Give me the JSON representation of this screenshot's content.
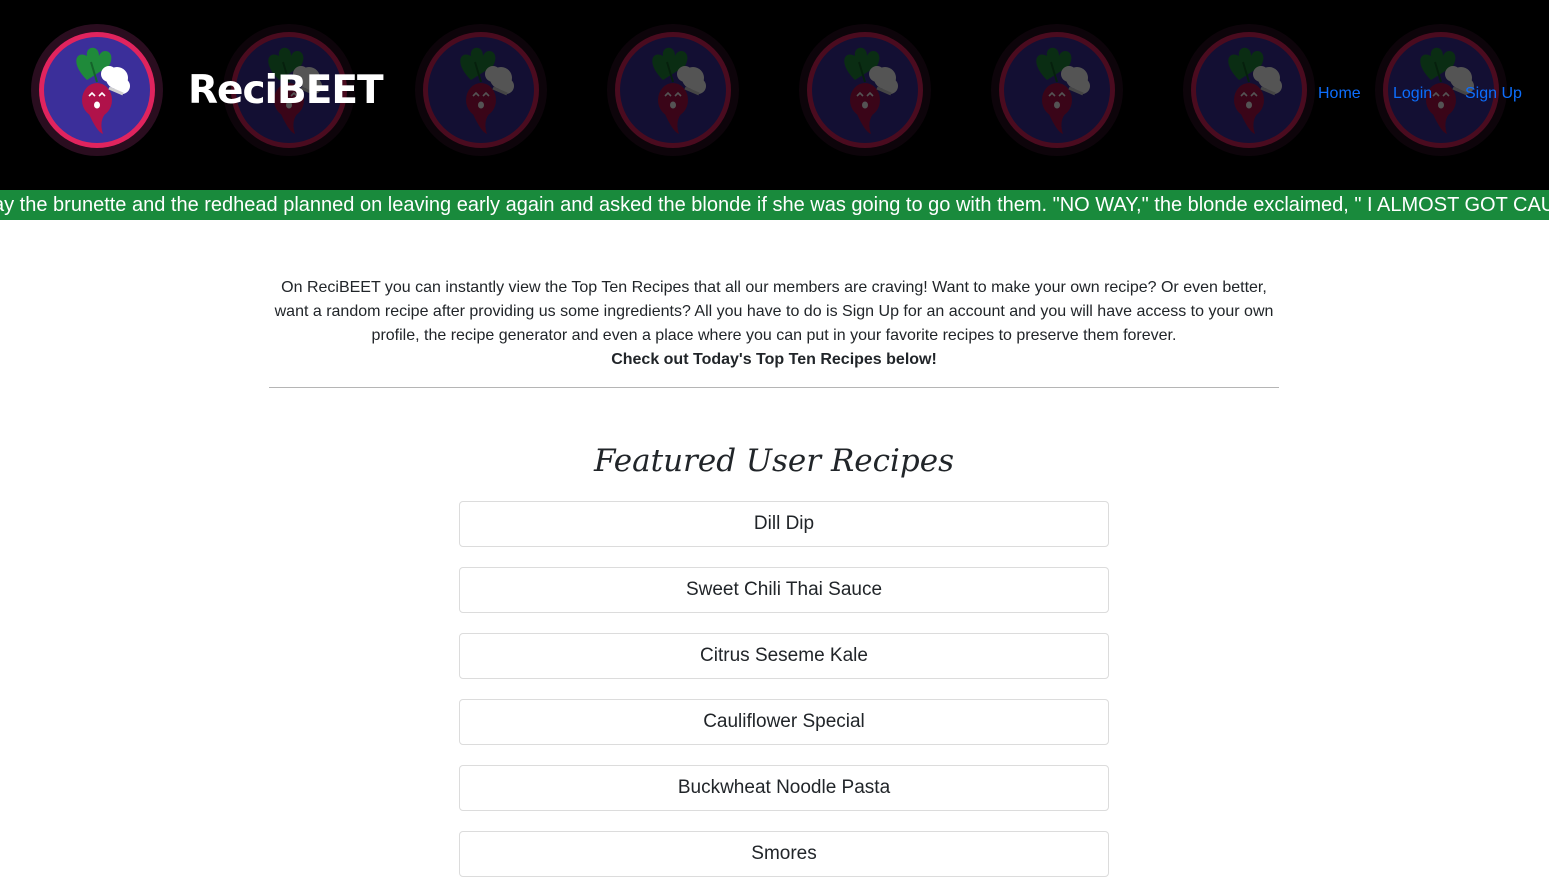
{
  "header": {
    "brand": "ReciBEET",
    "nav": {
      "home": "Home",
      "login": "Login",
      "signup": "Sign Up"
    }
  },
  "ticker": {
    "text": "ay the brunette and the redhead planned on leaving early again and asked the blonde if she was going to go with them. \"NO WAY,\" the blonde exclaimed, \" I ALMOST GOT CAUGHT"
  },
  "intro": {
    "text": "On ReciBEET you can instantly view the Top Ten Recipes that all our members are craving! Want to make your own recipe? Or even better, want a random recipe after providing us some ingredients? All you have to do is Sign Up for an account and you will have access to your own profile, the recipe generator and even a place where you can put in your favorite recipes to preserve them forever.",
    "cta": "Check out Today's Top Ten Recipes below!"
  },
  "featured": {
    "title": "Featured User Recipes",
    "recipes": [
      "Dill Dip",
      "Sweet Chili Thai Sauce",
      "Citrus Seseme Kale",
      "Cauliflower Special",
      "Buckwheat Noodle Pasta",
      "Smores"
    ]
  },
  "colors": {
    "header_bg": "#000000",
    "ticker_bg": "#198a3c",
    "nav_link": "#0d6efd",
    "logo_ring": "#e0245e",
    "logo_fill": "#3b2f9a",
    "beet": "#b0124a",
    "leaf": "#1f8a3a"
  },
  "icons": {
    "logo": "beet-chef-icon"
  }
}
